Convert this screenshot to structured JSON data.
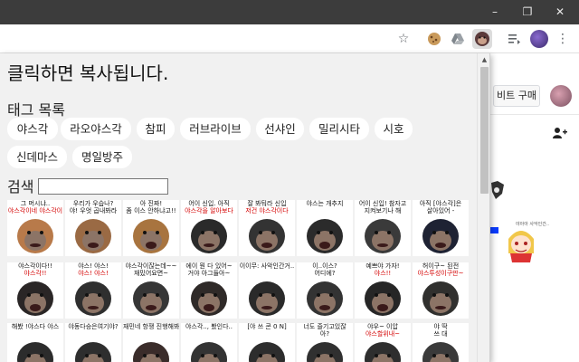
{
  "popup": {
    "title": "클릭하면 복사됩니다.",
    "tags_heading": "태그 목록",
    "tags": [
      "야스각",
      "라오야스각",
      "참피",
      "러브라이브",
      "선샤인",
      "밀리시타",
      "시호",
      "신데마스",
      "명일방주"
    ],
    "search_label": "검색",
    "search_value": ""
  },
  "thumbnails": [
    {
      "line1": "그 머시냐..",
      "line2": "야스각이네 야스각이",
      "skin": "#b87a4a"
    },
    {
      "line1": "우리가 우습나?",
      "line2": "야! 우엇 곱내봐라",
      "skin": "#9a6a44"
    },
    {
      "line1": "아 진짜!",
      "line2": "좀 이스 안하냐고!!",
      "skin": "#a8743f"
    },
    {
      "line1": "어이 신입. 아직",
      "line2": "야스각을 알아보다",
      "skin": "#2a2a2a"
    },
    {
      "line1": "잘 봐둬라 신입",
      "line2": "저건 야스각이다",
      "skin": "#333333"
    },
    {
      "line1": "야스는 개추지",
      "line2": "",
      "skin": "#2b2b2b"
    },
    {
      "line1": "어이 신입! 참자고",
      "line2": "지켜보기나 해",
      "skin": "#3a3a3a"
    },
    {
      "line1": "아직 [야스각]은",
      "line2": "살아있어 -",
      "skin": "#1e2233"
    },
    {
      "line1": "야스각이다!!",
      "line2": "야스각!!",
      "skin": "#2a2626"
    },
    {
      "line1": "야스! 야스!",
      "line2": "야스! 야스!",
      "skin": "#2f2f2f"
    },
    {
      "line1": "야스각이잖는데~~",
      "line2": "재밌어요면~",
      "skin": "#363636"
    },
    {
      "line1": "에이 뭔 다 있어~",
      "line2": "거야 아그들아~",
      "skin": "#2f2a28"
    },
    {
      "line1": "이이무: 사악인간거..",
      "line2": "",
      "skin": "#2a2a2a"
    },
    {
      "line1": "이..이스?",
      "line2": "어디에?",
      "skin": "#333333"
    },
    {
      "line1": "예쁘야 가자!",
      "line2": "야스!!",
      "skin": "#262626"
    },
    {
      "line1": "허이구~ 된전",
      "line2": "야스투성이구만~",
      "skin": "#30302e"
    },
    {
      "line1": "해봤 !야스다 야스",
      "line2": "",
      "skin": "#2c2c2c"
    },
    {
      "line1": "야동다승은여기야?",
      "line2": "",
      "skin": "#2e2e2e"
    },
    {
      "line1": "재민네 항쟁 진행해봐",
      "line2": "",
      "skin": "#3a2c2a"
    },
    {
      "line1": "야스각.., 봤인다..",
      "line2": "",
      "skin": "#333333"
    },
    {
      "line1": "[야 쓰 콘 0 N]",
      "line2": "",
      "skin": "#2d2d2d"
    },
    {
      "line1": "너도 즐기고있잖",
      "line2": "아?",
      "skin": "#303030"
    },
    {
      "line1": "야우~ 이압",
      "line2": "야스할위내~",
      "skin": "#2e2e2e"
    },
    {
      "line1": "야 딱",
      "line2": "쓰 대",
      "skin": "#3a3a3a"
    }
  ],
  "background_page": {
    "buy_button": "비트 구매",
    "side_note": "야아아 사악인간.."
  },
  "colors": {
    "popup_bg": "#f1f1f1",
    "titlebar": "#3c3c3c",
    "accent_red": "#d40000",
    "accent_blue": "#0a3cff"
  },
  "icons": {
    "window": [
      "minimize-icon",
      "restore-icon",
      "close-icon"
    ],
    "toolbar": [
      "bookmark-star-icon",
      "cookie-extension-icon",
      "drive-extension-icon",
      "chimp-extension-icon",
      "reading-list-icon",
      "profile-avatar-icon",
      "menu-icon"
    ]
  }
}
